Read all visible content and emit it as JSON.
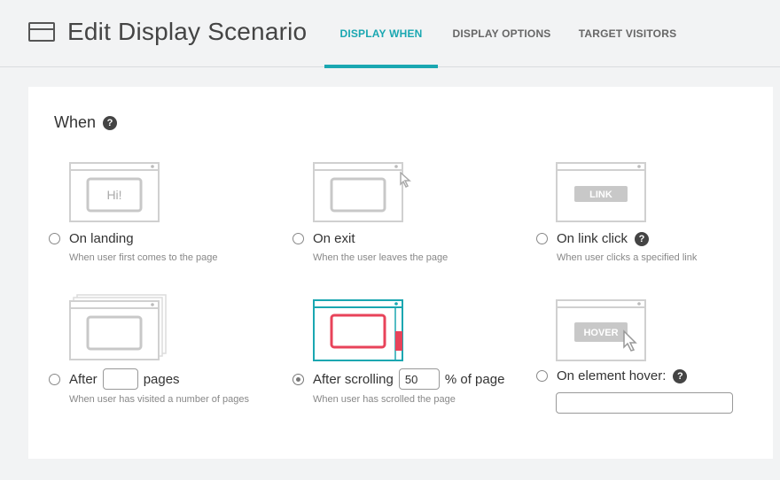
{
  "header": {
    "title": "Edit Display Scenario",
    "tabs": [
      {
        "label": "DISPLAY WHEN"
      },
      {
        "label": "DISPLAY OPTIONS"
      },
      {
        "label": "TARGET VISITORS"
      }
    ]
  },
  "when": {
    "label": "When",
    "options": [
      {
        "label": "On landing",
        "description": "When user first comes to the page",
        "illustration_text": "Hi!",
        "selected": false
      },
      {
        "label": "On exit",
        "description": "When the user leaves the page",
        "selected": false
      },
      {
        "label": "On link click",
        "description": "When user clicks a specified link",
        "illustration_text": "LINK",
        "selected": false
      },
      {
        "label_prefix": "After",
        "label_suffix": "pages",
        "input_value": "",
        "description": "When user has visited a number of pages",
        "selected": false
      },
      {
        "label_prefix": "After scrolling",
        "label_suffix": "% of page",
        "input_value": "50",
        "description": "When user has scrolled the page",
        "selected": true
      },
      {
        "label": "On element hover:",
        "input_value": "",
        "illustration_text": "HOVER",
        "selected": false
      }
    ]
  },
  "colors": {
    "accent": "#1aa7b1",
    "highlight": "#e8435a",
    "illustration_gray": "#cfcfcf"
  }
}
